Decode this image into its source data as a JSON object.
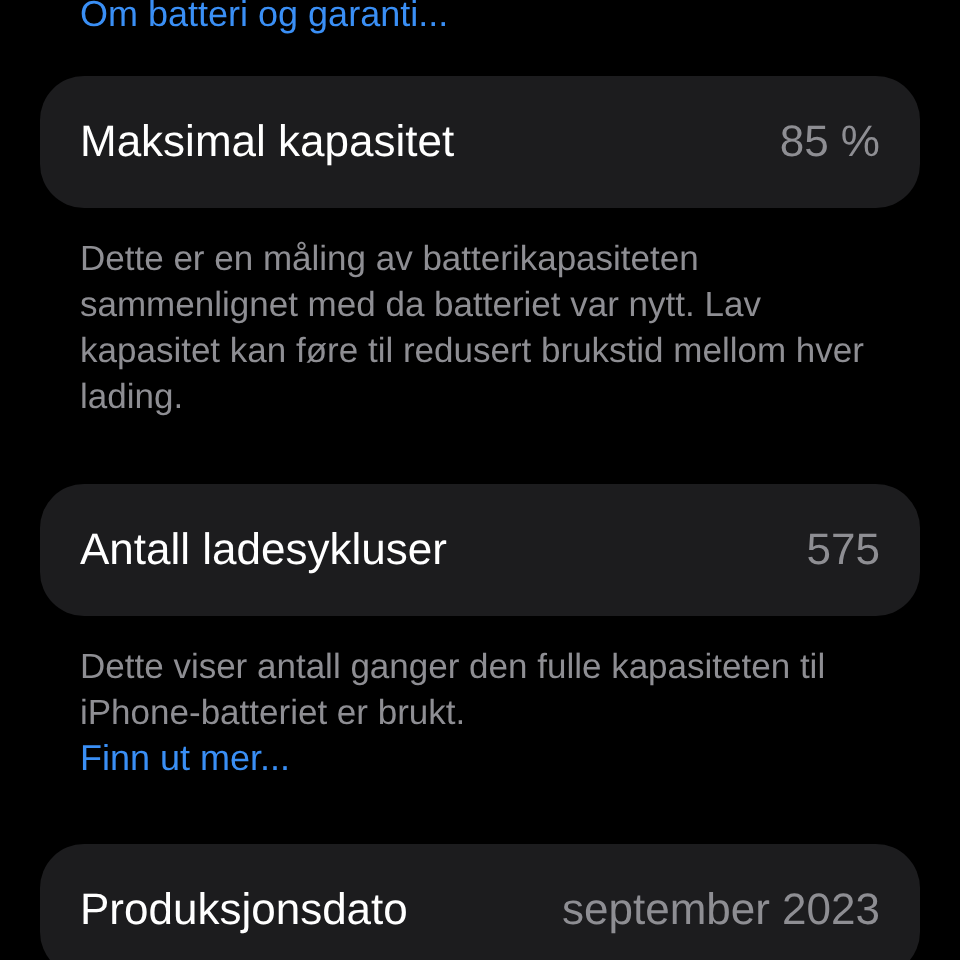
{
  "top_link": "Om batteri og garanti...",
  "sections": [
    {
      "label": "Maksimal kapasitet",
      "value": "85 %",
      "description": "Dette er en måling av batterikapasiteten sammenlignet med da batteriet var nytt. Lav kapasitet kan føre til redusert brukstid mellom hver lading."
    },
    {
      "label": "Antall ladesykluser",
      "value": "575",
      "description": "Dette viser antall ganger den fulle kapasiteten til iPhone-batteriet er brukt.",
      "link": "Finn ut mer..."
    },
    {
      "label": "Produksjonsdato",
      "value": "september 2023"
    }
  ]
}
